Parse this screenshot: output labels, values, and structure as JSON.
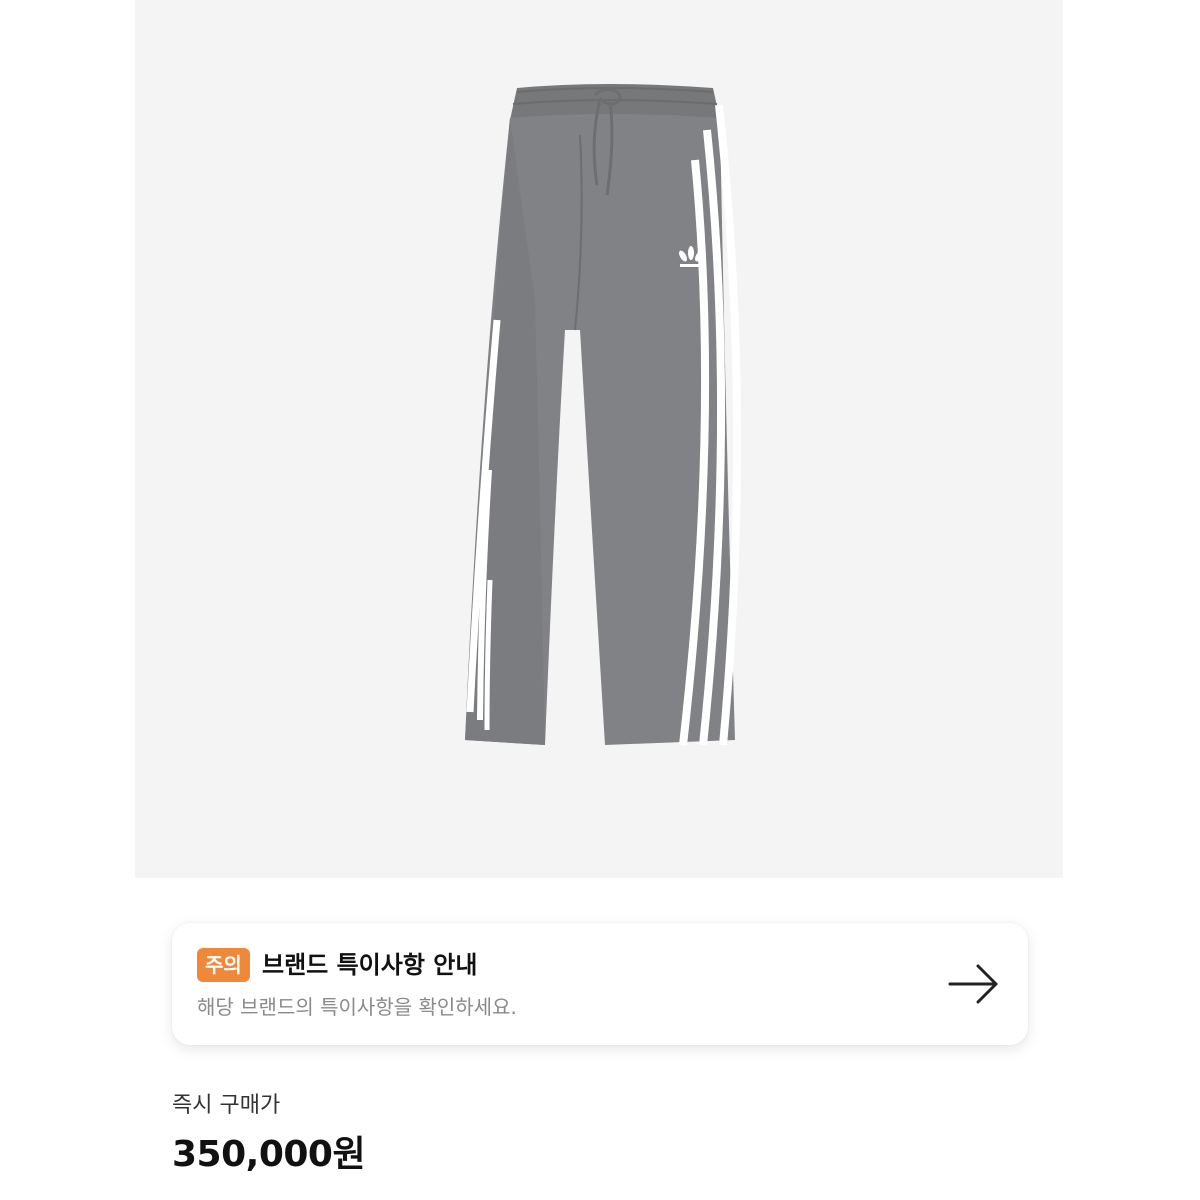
{
  "product": {
    "image_alt": "grey wide-leg track pants with three white side stripes"
  },
  "notice": {
    "badge": "주의",
    "title": "브랜드 특이사항 안내",
    "subtitle": "해당 브랜드의 특이사항을 확인하세요.",
    "arrow_icon": "arrow-right-icon"
  },
  "price": {
    "label": "즉시 구매가",
    "value": "350,000원"
  },
  "colors": {
    "badge": "#f0883a",
    "pants": "#7f8183",
    "stripes": "#ffffff",
    "image_background": "#f4f4f4"
  }
}
